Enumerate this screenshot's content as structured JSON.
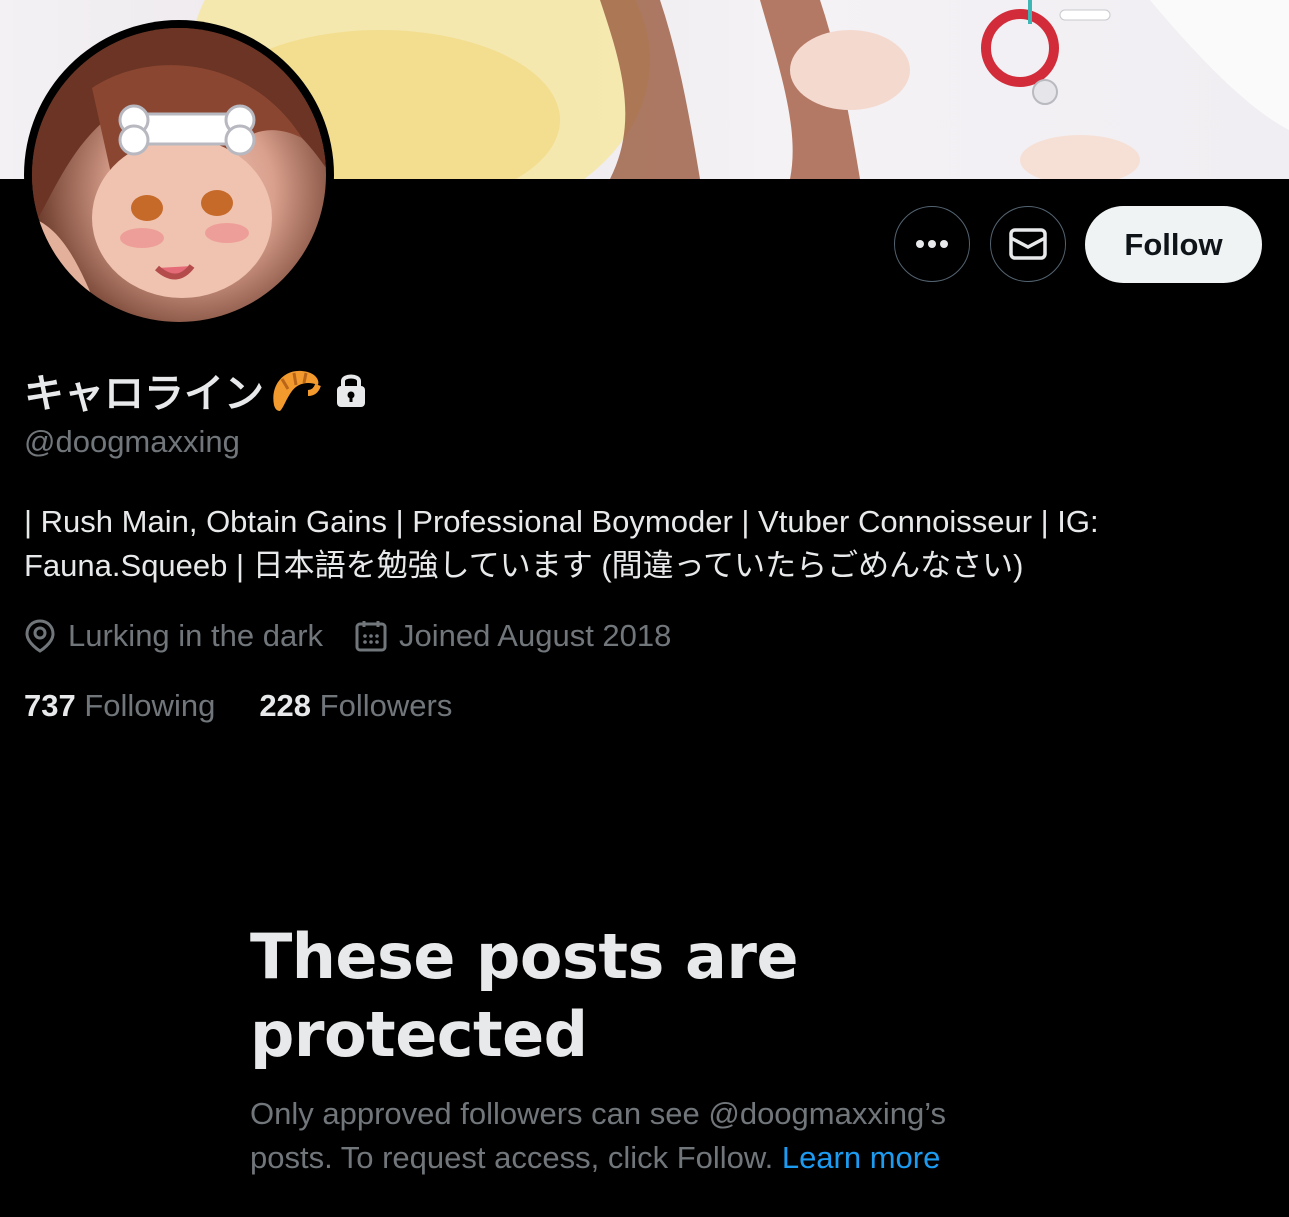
{
  "profile": {
    "display_name": "キャロライン",
    "display_name_emoji": "croissant",
    "protected_icon": "lock-icon",
    "handle": "@doogmaxxing",
    "bio": "| Rush Main, Obtain Gains | Professional Boymoder | Vtuber Connoisseur | IG: Fauna.Squeeb | 日本語を勉強しています (間違っていたらごめんなさい)",
    "location": "Lurking in the dark",
    "joined": "Joined August 2018",
    "following_count": "737",
    "following_label": "Following",
    "followers_count": "228",
    "followers_label": "Followers"
  },
  "actions": {
    "more_icon": "more-icon",
    "message_icon": "envelope-icon",
    "follow_label": "Follow"
  },
  "protected_notice": {
    "title": "These posts are protected",
    "description": "Only approved followers can see @doogmaxxing’s posts. To request access, click Follow.",
    "link_label": "Learn more"
  },
  "colors": {
    "background": "#000000",
    "primary_text": "#e7e9ea",
    "secondary_text": "#71767b",
    "link": "#1d9bf0",
    "follow_button_bg": "#eff3f4"
  }
}
